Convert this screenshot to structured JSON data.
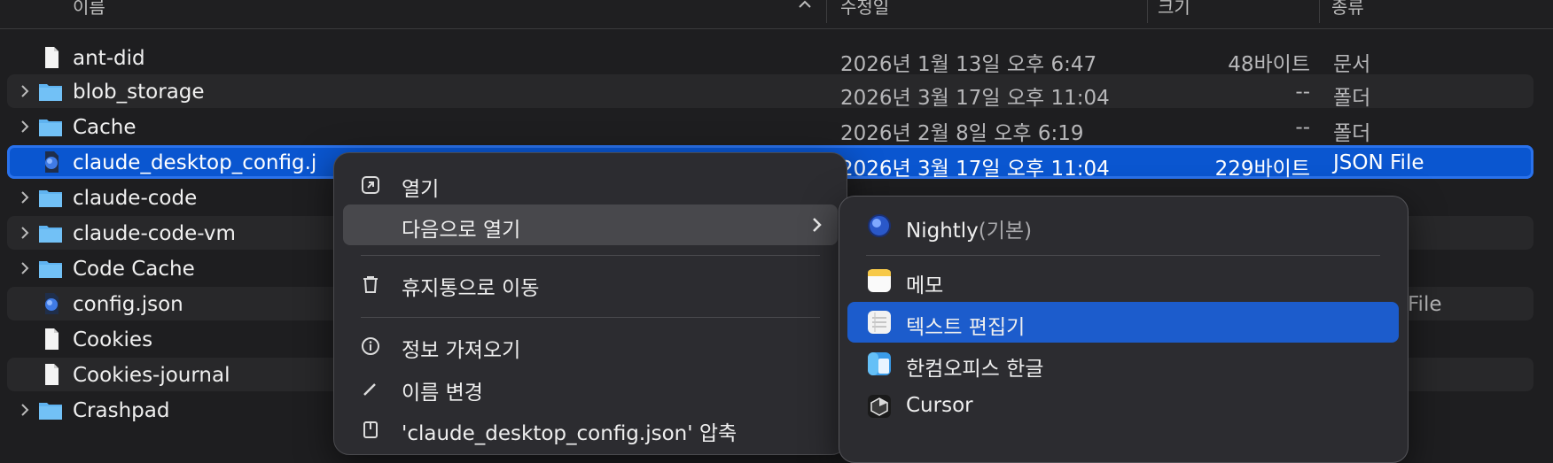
{
  "columns": {
    "name": "이름",
    "modified": "수정일",
    "size": "크기",
    "kind": "종류"
  },
  "files": [
    {
      "name": "ant-did",
      "date": "2026년 1월 13일 오후 6:47",
      "size": "48바이트",
      "kind": "문서",
      "type": "doc",
      "expandable": false
    },
    {
      "name": "blob_storage",
      "date": "2026년 3월 17일 오후 11:04",
      "size": "--",
      "kind": "폴더",
      "type": "folder",
      "expandable": true
    },
    {
      "name": "Cache",
      "date": "2026년 2월 8일 오후 6:19",
      "size": "--",
      "kind": "폴더",
      "type": "folder",
      "expandable": true
    },
    {
      "name": "claude_desktop_config.j",
      "date": "2026년 3월 17일 오후 11:04",
      "size": "229바이트",
      "kind": "JSON File",
      "type": "json",
      "expandable": false,
      "selected": true
    },
    {
      "name": "claude-code",
      "date": "",
      "size": "",
      "kind": "",
      "type": "folder",
      "expandable": true
    },
    {
      "name": "claude-code-vm",
      "date": "",
      "size": "",
      "kind": "",
      "type": "folder",
      "expandable": true
    },
    {
      "name": "Code Cache",
      "date": "",
      "size": "",
      "kind": "",
      "type": "folder",
      "expandable": true
    },
    {
      "name": "config.json",
      "date": "",
      "size": "",
      "kind": "File",
      "type": "json",
      "expandable": false
    },
    {
      "name": "Cookies",
      "date": "",
      "size": "",
      "kind": "",
      "type": "doc",
      "expandable": false
    },
    {
      "name": "Cookies-journal",
      "date": "",
      "size": "",
      "kind": "",
      "type": "doc",
      "expandable": false
    },
    {
      "name": "Crashpad",
      "date": "",
      "size": "",
      "kind": "",
      "type": "folder",
      "expandable": true
    }
  ],
  "context_menu": {
    "items": [
      {
        "label": "열기",
        "icon": "open-icon"
      },
      {
        "label": "다음으로 열기",
        "icon": "",
        "has_submenu": true
      },
      {
        "label": "휴지통으로 이동",
        "icon": "trash-icon"
      },
      {
        "label": "정보 가져오기",
        "icon": "info-icon"
      },
      {
        "label": "이름 변경",
        "icon": "pencil-icon"
      },
      {
        "label": "'claude_desktop_config.json' 압축",
        "icon": "archive-icon"
      }
    ]
  },
  "open_with": {
    "items": [
      {
        "label": "Nightly",
        "note": "(기본)",
        "icon": "nightly-icon"
      },
      {
        "label": "메모",
        "note": "",
        "icon": "notes-icon"
      },
      {
        "label": "텍스트 편집기",
        "note": "",
        "icon": "textedit-icon"
      },
      {
        "label": "한컴오피스 한글",
        "note": "",
        "icon": "hancom-icon"
      },
      {
        "label": "Cursor",
        "note": "",
        "icon": "cursor-app-icon"
      }
    ]
  },
  "colors": {
    "selection": "#0a56d0",
    "highlight": "#1c5ccc",
    "folder": "#5fb3f0"
  }
}
